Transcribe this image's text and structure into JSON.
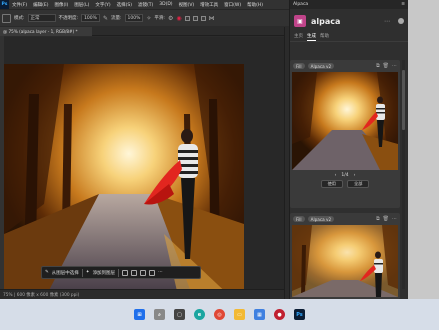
{
  "menubar": {
    "logo": "Ps",
    "items": [
      "文件(F)",
      "编辑(E)",
      "图像(I)",
      "图层(L)",
      "文字(Y)",
      "选择(S)",
      "滤镜(T)",
      "3D(D)",
      "视图(V)",
      "增效工具",
      "窗口(W)",
      "帮助(H)"
    ]
  },
  "optbar": {
    "mode_label": "模式:",
    "mode_value": "正常",
    "opacity_label": "不透明度:",
    "opacity_value": "100%",
    "flow_label": "流量:",
    "flow_value": "100%",
    "smooth_label": "平滑:"
  },
  "document": {
    "tab_title": "@ 75% (alpaca layer - 1, RGB/8#) *"
  },
  "context_bar": {
    "button1": "从图层中选择",
    "button2": "添加到图层"
  },
  "statusbar": {
    "text": "75% | 600 像素 x 600 像素 (300 ppi)"
  },
  "panel": {
    "header": "Alpaca",
    "app_title": "alpaca",
    "nav": [
      "主页",
      "生成",
      "帮助"
    ],
    "nav_active": 1,
    "card1": {
      "chip1": "Fill",
      "chip2": "Alpaca v2",
      "pager": "1/4",
      "btn1": "使用",
      "btn2": "全部"
    },
    "card2": {
      "chip1": "Fill",
      "chip2": "Alpaca v2"
    }
  },
  "colors": {
    "accent": "#c0448a",
    "ps_blue": "#31a8ff",
    "ui_dark": "#2b2b2b"
  },
  "taskbar_icons": [
    "windows-start-icon",
    "search-icon",
    "task-view-icon",
    "edge-icon",
    "chrome-icon",
    "file-explorer-icon",
    "store-icon",
    "recorder-icon",
    "photoshop-icon"
  ]
}
